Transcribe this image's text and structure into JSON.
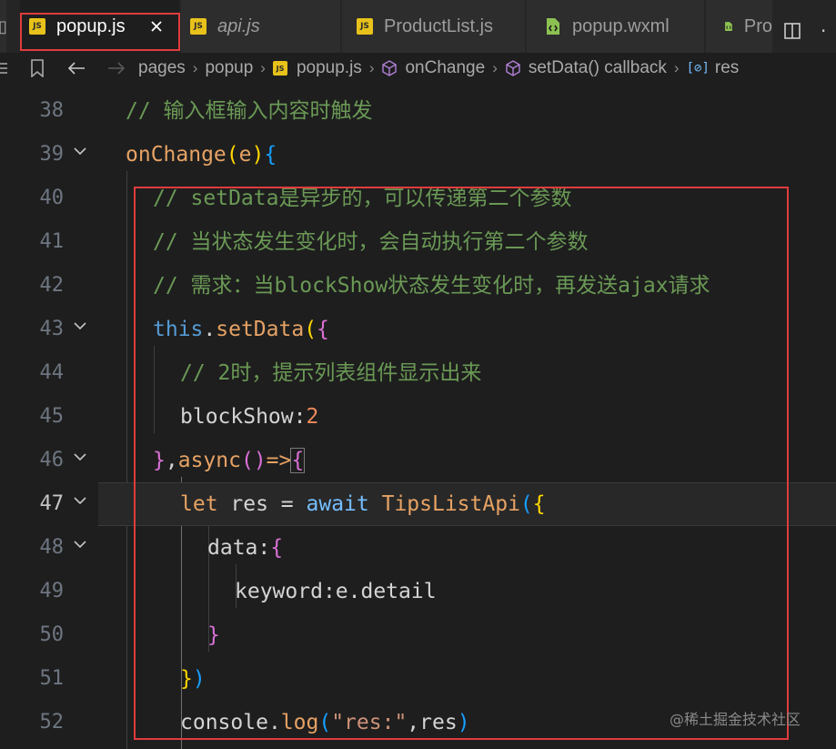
{
  "tabs": [
    {
      "label": "popup.js",
      "icon": "js-file-icon",
      "active": true,
      "italic": false
    },
    {
      "label": "api.js",
      "icon": "js-file-icon",
      "active": false,
      "italic": true
    },
    {
      "label": "ProductList.js",
      "icon": "js-file-icon",
      "active": false,
      "italic": false
    },
    {
      "label": "popup.wxml",
      "icon": "wxml-file-icon",
      "active": false,
      "italic": false
    },
    {
      "label": "Pro",
      "icon": "wxml-file-icon",
      "active": false,
      "italic": false
    }
  ],
  "js_badge": "JS",
  "breadcrumb": {
    "folder1": "pages",
    "folder2": "popup",
    "file": "popup.js",
    "symbol1": "onChange",
    "symbol2": "setData() callback",
    "symbol3": "res"
  },
  "lines": [
    {
      "n": "38"
    },
    {
      "n": "39"
    },
    {
      "n": "40"
    },
    {
      "n": "41"
    },
    {
      "n": "42"
    },
    {
      "n": "43"
    },
    {
      "n": "44"
    },
    {
      "n": "45"
    },
    {
      "n": "46"
    },
    {
      "n": "47"
    },
    {
      "n": "48"
    },
    {
      "n": "49"
    },
    {
      "n": "50"
    },
    {
      "n": "51"
    },
    {
      "n": "52"
    }
  ],
  "code": {
    "l38": "// 输入框输入内容时触发",
    "l39_fn": "onChange",
    "l39_p1": "(",
    "l39_param": "e",
    "l39_p2": ")",
    "l39_b": "{",
    "l40": "// setData是异步的，可以传递第二个参数",
    "l41": "// 当状态发生变化时，会自动执行第二个参数",
    "l42": "// 需求：当blockShow状态发生变化时，再发送ajax请求",
    "l43_this": "this",
    "l43_dot": ".",
    "l43_fn": "setData",
    "l43_p": "(",
    "l43_b": "{",
    "l44": "// 2时，提示列表组件显示出来",
    "l45_key": "blockShow",
    "l45_colon": ":",
    "l45_val": "2",
    "l46_b": "}",
    "l46_comma": ",",
    "l46_async": "async",
    "l46_parens": "()",
    "l46_arrow": "=>",
    "l46_ob": "{",
    "l47_let": "let",
    "l47_res": " res ",
    "l47_eq": "=",
    "l47_await": " await ",
    "l47_fn": "TipsListApi",
    "l47_p": "(",
    "l47_b": "{",
    "l48_key": "data",
    "l48_colon": ":",
    "l48_b": "{",
    "l49_key": "keyword",
    "l49_colon": ":",
    "l49_val": "e.detail",
    "l50_b": "}",
    "l51_b": "}",
    "l51_p": ")",
    "l52_obj": "console",
    "l52_dot": ".",
    "l52_fn": "log",
    "l52_p1": "(",
    "l52_str": "\"res:\"",
    "l52_comma": ",",
    "l52_res": "res",
    "l52_p2": ")"
  },
  "watermark": "@稀土掘金技术社区",
  "colors": {
    "background": "#1e1e1e",
    "highlight_box": "#e03c3c",
    "comment": "#6a9955",
    "js_badge": "#e8c21a"
  }
}
